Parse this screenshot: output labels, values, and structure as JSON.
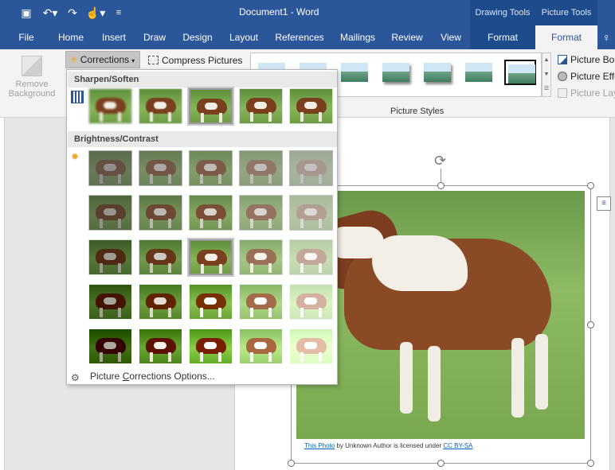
{
  "window": {
    "title": "Document1  -  Word",
    "context_tabs": [
      "Drawing Tools",
      "Picture Tools"
    ]
  },
  "quick_access": {
    "save_icon": "save-icon",
    "undo_icon": "undo-icon",
    "redo_icon": "redo-icon",
    "touch_icon": "touch-mode-icon",
    "customize_icon": "customize-icon"
  },
  "tabs": [
    {
      "label": "File"
    },
    {
      "label": "Home"
    },
    {
      "label": "Insert"
    },
    {
      "label": "Draw"
    },
    {
      "label": "Design"
    },
    {
      "label": "Layout"
    },
    {
      "label": "References"
    },
    {
      "label": "Mailings"
    },
    {
      "label": "Review"
    },
    {
      "label": "View"
    },
    {
      "label": "Format"
    },
    {
      "label": "Format"
    }
  ],
  "ribbon": {
    "remove_background": "Remove Background",
    "corrections": "Corrections",
    "compress_pictures": "Compress Pictures",
    "picture_styles_label": "Picture Styles",
    "picture_border": "Picture Border",
    "picture_effects": "Picture Effects",
    "picture_layout": "Picture Layout"
  },
  "corrections_menu": {
    "sharpen_header": "Sharpen/Soften",
    "brightness_header": "Brightness/Contrast",
    "options_label": "Picture Corrections Options...",
    "options_hotkey": "C"
  },
  "caption": {
    "link1": "This Photo",
    "middle": " by Unknown Author is licensed under ",
    "link2": "CC BY-SA"
  },
  "colors": {
    "word_blue": "#2b579a",
    "context_blue": "#1e4b8c",
    "link_blue": "#0563c1"
  }
}
